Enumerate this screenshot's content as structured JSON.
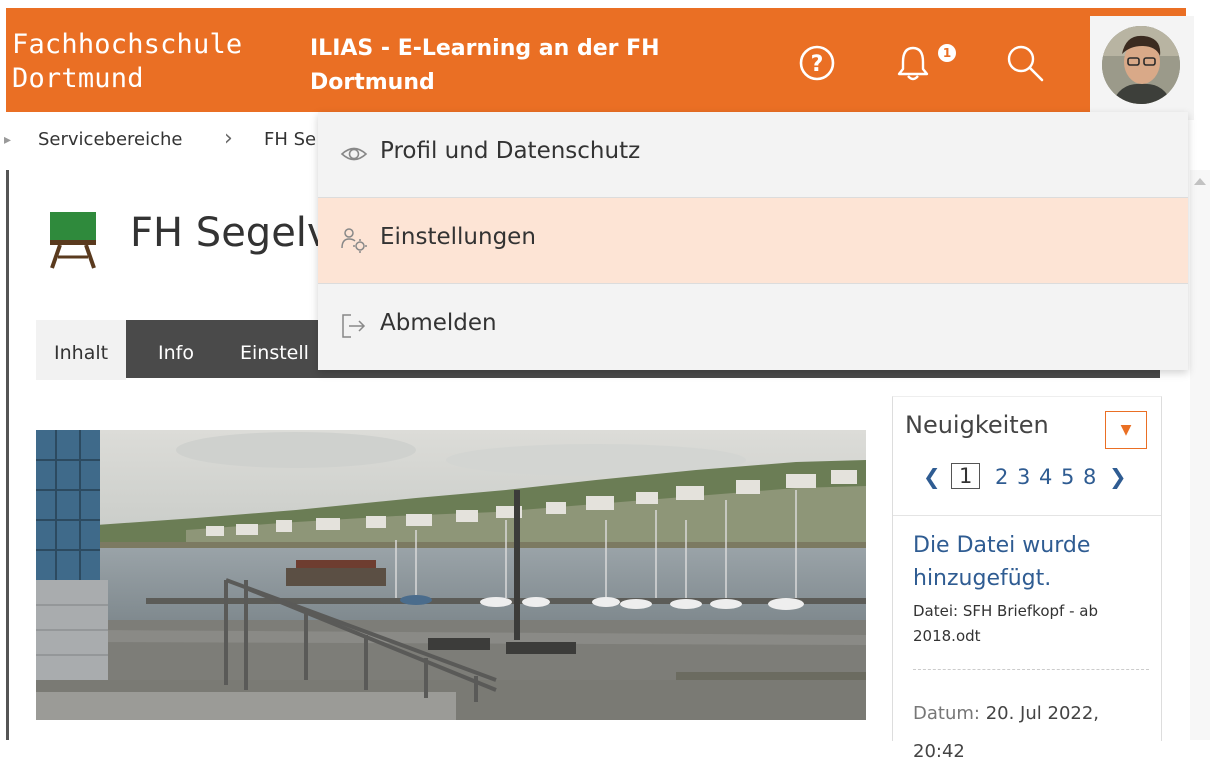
{
  "header": {
    "logo_line1": "Fachhochschule",
    "logo_line2": "Dortmund",
    "title_line1": "ILIAS - E-Learning an der FH",
    "title_line2": "Dortmund",
    "notification_count": "1",
    "accent_color": "#ea6f24"
  },
  "breadcrumb": {
    "items": [
      "Servicebereiche",
      "FH Se"
    ]
  },
  "course": {
    "title": "FH Segelv"
  },
  "tabs": [
    {
      "label": "Inhalt",
      "active": true
    },
    {
      "label": "Info",
      "active": false
    },
    {
      "label": "Einstell",
      "active": false
    }
  ],
  "user_menu": {
    "items": [
      {
        "label": "Profil und Datenschutz",
        "icon": "eye-icon"
      },
      {
        "label": "Einstellungen",
        "icon": "user-settings-icon"
      },
      {
        "label": "Abmelden",
        "icon": "logout-icon"
      }
    ]
  },
  "news": {
    "title": "Neuigkeiten",
    "pages": [
      "1",
      "2",
      "3",
      "4",
      "5",
      "8"
    ],
    "current_page": "1",
    "item_title": "Die Datei wurde hinzugefügt.",
    "item_file": "Datei: SFH Briefkopf - ab 2018.odt",
    "date_label": "Datum:",
    "date_value": "20. Jul 2022,",
    "date_time": "20:42"
  }
}
